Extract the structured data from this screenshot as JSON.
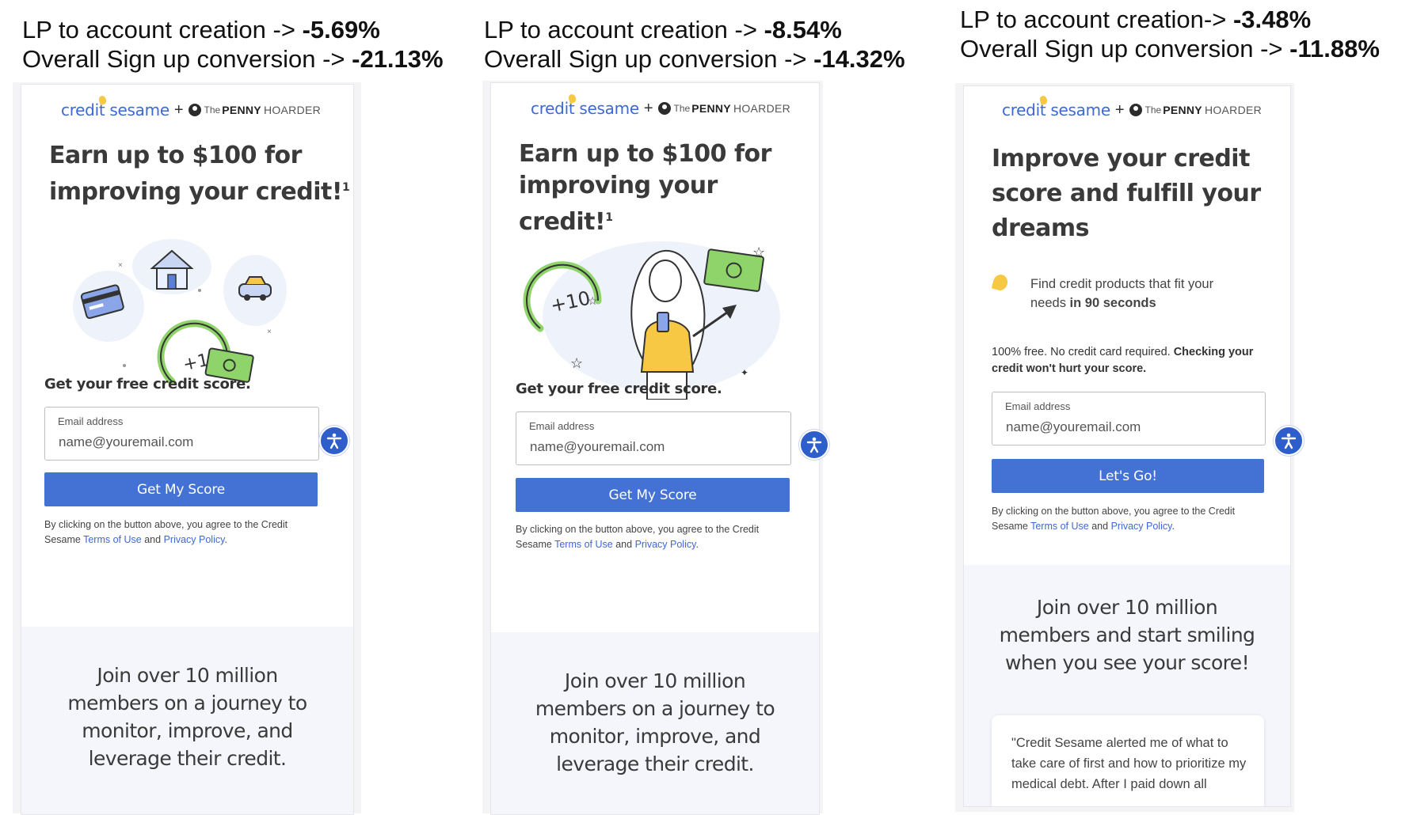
{
  "variants": [
    {
      "stats": {
        "lp_label": "LP to account creation -> ",
        "lp_value": "-5.69%",
        "overall_label": "Overall Sign up conversion -> ",
        "overall_value": "-21.13%"
      },
      "logo": {
        "brand": "credit sesame",
        "plus": "+",
        "the": "The",
        "penny": "PENNY",
        "hoarder": "HOARDER"
      },
      "headline_line1": "Earn up to $100 for",
      "headline_line2": "improving your credit!",
      "headline_sup": "1",
      "illustration_label": "+10",
      "illustration": "credit-card-house-car-gauge-cash",
      "subhead": "Get your free credit score.",
      "email": {
        "label": "Email address",
        "placeholder": "name@youremail.com"
      },
      "button": "Get My Score",
      "legal": {
        "prefix": "By clicking on the button above, you agree to the Credit Sesame ",
        "terms": "Terms of Use",
        "and": " and ",
        "privacy": "Privacy Policy",
        "suffix": "."
      },
      "bottom_lines": [
        "Join over 10 million",
        "members on a journey to",
        "monitor, improve, and",
        "leverage their credit."
      ]
    },
    {
      "stats": {
        "lp_label": "LP to account creation -> ",
        "lp_value": "-8.54%",
        "overall_label": "Overall Sign up conversion -> ",
        "overall_value": "-14.32%"
      },
      "logo": {
        "brand": "credit sesame",
        "plus": "+",
        "the": "The",
        "penny": "PENNY",
        "hoarder": "HOARDER"
      },
      "headline_line1": "Earn up to $100 for",
      "headline_line2": "improving your credit!",
      "headline_sup": "1",
      "illustration_label": "+10",
      "illustration": "woman-with-phone-gauge-cash",
      "subhead": "Get your free credit score.",
      "email": {
        "label": "Email address",
        "placeholder": "name@youremail.com"
      },
      "button": "Get My Score",
      "legal": {
        "prefix": "By clicking on the button above, you agree to the Credit Sesame ",
        "terms": "Terms of Use",
        "and": " and ",
        "privacy": "Privacy Policy",
        "suffix": "."
      },
      "bottom_lines": [
        "Join over 10 million",
        "members on a journey to",
        "monitor, improve, and",
        "leverage their credit."
      ]
    },
    {
      "stats": {
        "lp_label": "LP to account creation-> ",
        "lp_value": "-3.48%",
        "overall_label": "Overall Sign up conversion -> ",
        "overall_value": "-11.88%"
      },
      "logo": {
        "brand": "credit sesame",
        "plus": "+",
        "the": "The",
        "penny": "PENNY",
        "hoarder": "HOARDER"
      },
      "headline_lines": [
        "Improve your credit",
        "score and fulfill your",
        "dreams"
      ],
      "bullet": {
        "text": "Find credit products that fit your needs ",
        "bold": "in 90 seconds"
      },
      "free": {
        "text": "100% free. No credit card required. ",
        "bold": "Checking your credit won't hurt your score."
      },
      "email": {
        "label": "Email address",
        "placeholder": "name@youremail.com"
      },
      "button": "Let's Go!",
      "legal": {
        "prefix": "By clicking on the button above, you agree to the Credit Sesame ",
        "terms": "Terms of Use",
        "and": " and ",
        "privacy": "Privacy Policy",
        "suffix": "."
      },
      "bottom_lines": [
        "Join over 10 million",
        "members and start smiling",
        "when you see your score!"
      ],
      "quote": "\"Credit Sesame alerted me of what to take care of first and how to prioritize my medical debt. After I paid down all"
    }
  ],
  "colors": {
    "brand_blue": "#4471d4",
    "accent_yellow": "#f7c844",
    "cash_green": "#8fd46a",
    "a11y_blue": "#2e5ec9"
  },
  "icons": {
    "accessibility": "accessibility-icon",
    "logo_dot": "sesame-seed-icon",
    "penny_hoarder": "penny-hoarder-icon"
  }
}
